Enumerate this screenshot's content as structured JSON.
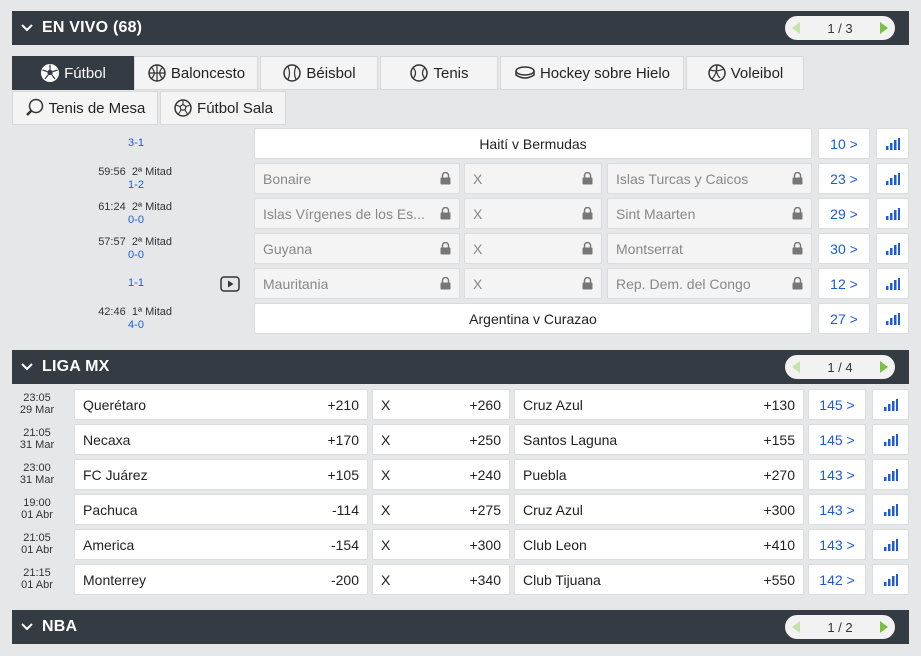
{
  "live": {
    "title": "EN VIVO (68)",
    "pager": "1 / 3",
    "tabs": [
      {
        "label": "Fútbol",
        "icon": "soccer-ball-icon"
      },
      {
        "label": "Baloncesto",
        "icon": "basketball-icon"
      },
      {
        "label": "Béisbol",
        "icon": "baseball-icon"
      },
      {
        "label": "Tenis",
        "icon": "tennis-ball-icon"
      },
      {
        "label": "Hockey sobre Hielo",
        "icon": "hockey-puck-icon"
      },
      {
        "label": "Voleibol",
        "icon": "volleyball-icon"
      },
      {
        "label": "Tenis de Mesa",
        "icon": "ping-pong-icon"
      },
      {
        "label": "Fútbol Sala",
        "icon": "futsal-ball-icon"
      }
    ],
    "rows": [
      {
        "time": "",
        "period": "",
        "score": "3-1",
        "title": "Haití v Bermudas",
        "more": "10 >"
      },
      {
        "time": "59:56",
        "period": "2ª Mitad",
        "score": "1-2",
        "home": "Bonaire",
        "draw": "X",
        "away": "Islas Turcas y Caicos",
        "more": "23 >"
      },
      {
        "time": "61:24",
        "period": "2ª Mitad",
        "score": "0-0",
        "home": "Islas Vírgenes de los Es...",
        "draw": "X",
        "away": "Sint Maarten",
        "more": "29 >"
      },
      {
        "time": "57:57",
        "period": "2ª Mitad",
        "score": "0-0",
        "home": "Guyana",
        "draw": "X",
        "away": "Montserrat",
        "more": "30 >"
      },
      {
        "time": "",
        "period": "",
        "score": "1-1",
        "home": "Mauritania",
        "draw": "X",
        "away": "Rep. Dem. del Congo",
        "more": "12 >"
      },
      {
        "time": "42:46",
        "period": "1ª Mitad",
        "score": "4-0",
        "title": "Argentina v Curazao",
        "more": "27 >"
      }
    ]
  },
  "liga_mx": {
    "title": "LIGA MX",
    "pager": "1 / 4",
    "rows": [
      {
        "time": "23:05",
        "date": "29 Mar",
        "home": "Querétaro",
        "home_odd": "+210",
        "draw": "X",
        "draw_odd": "+260",
        "away": "Cruz Azul",
        "away_odd": "+130",
        "more": "145 >"
      },
      {
        "time": "21:05",
        "date": "31 Mar",
        "home": "Necaxa",
        "home_odd": "+170",
        "draw": "X",
        "draw_odd": "+250",
        "away": "Santos Laguna",
        "away_odd": "+155",
        "more": "145 >"
      },
      {
        "time": "23:00",
        "date": "31 Mar",
        "home": "FC Juárez",
        "home_odd": "+105",
        "draw": "X",
        "draw_odd": "+240",
        "away": "Puebla",
        "away_odd": "+270",
        "more": "143 >"
      },
      {
        "time": "19:00",
        "date": "01 Abr",
        "home": "Pachuca",
        "home_odd": "-114",
        "draw": "X",
        "draw_odd": "+275",
        "away": "Cruz Azul",
        "away_odd": "+300",
        "more": "143 >"
      },
      {
        "time": "21:05",
        "date": "01 Abr",
        "home": "America",
        "home_odd": "-154",
        "draw": "X",
        "draw_odd": "+300",
        "away": "Club Leon",
        "away_odd": "+410",
        "more": "143 >"
      },
      {
        "time": "21:15",
        "date": "01 Abr",
        "home": "Monterrey",
        "home_odd": "-200",
        "draw": "X",
        "draw_odd": "+340",
        "away": "Club Tijuana",
        "away_odd": "+550",
        "more": "142 >"
      }
    ]
  },
  "nba": {
    "title": "NBA",
    "pager": "1 / 2"
  },
  "colors": {
    "header_bg": "#343b42",
    "link_blue": "#1e5bd6",
    "pager_green": "#7ac143"
  }
}
